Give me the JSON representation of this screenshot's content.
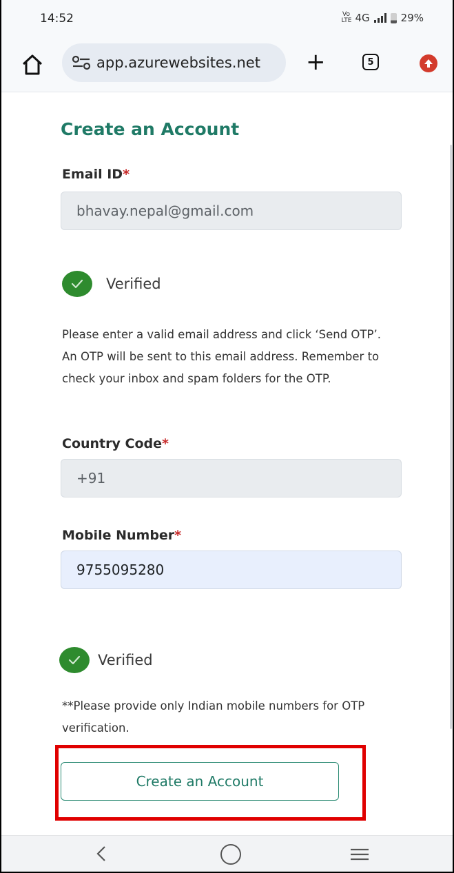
{
  "status_bar": {
    "time": "14:52",
    "network": "4G",
    "volte": "VoLTE",
    "battery": "29%"
  },
  "browser": {
    "url": "app.azurewebsites.net",
    "tab_count": "5",
    "icons": [
      "home-icon",
      "site-settings-icon",
      "new-tab-icon",
      "tab-switcher-icon",
      "update-icon"
    ]
  },
  "form": {
    "title": "Create an Account",
    "email_label": "Email ID",
    "email_value": "bhavay.nepal@gmail.com",
    "email_verified": "Verified",
    "email_help": "Please enter a valid email address and click ‘Send OTP’. An OTP will be sent to this email address. Remember to check your inbox and spam folders for the OTP.",
    "country_label": "Country Code",
    "country_value": "+91",
    "mobile_label": "Mobile Number",
    "mobile_value": "9755095280",
    "mobile_verified": "Verified",
    "mobile_note": "**Please provide only Indian mobile numbers for OTP verification.",
    "required_mark": "*",
    "submit_label": "Create an Account"
  },
  "colors": {
    "accent": "#1f7a66",
    "verified_green": "#2e8b2e",
    "required_red": "#c62828",
    "highlight_red": "#e00000"
  }
}
